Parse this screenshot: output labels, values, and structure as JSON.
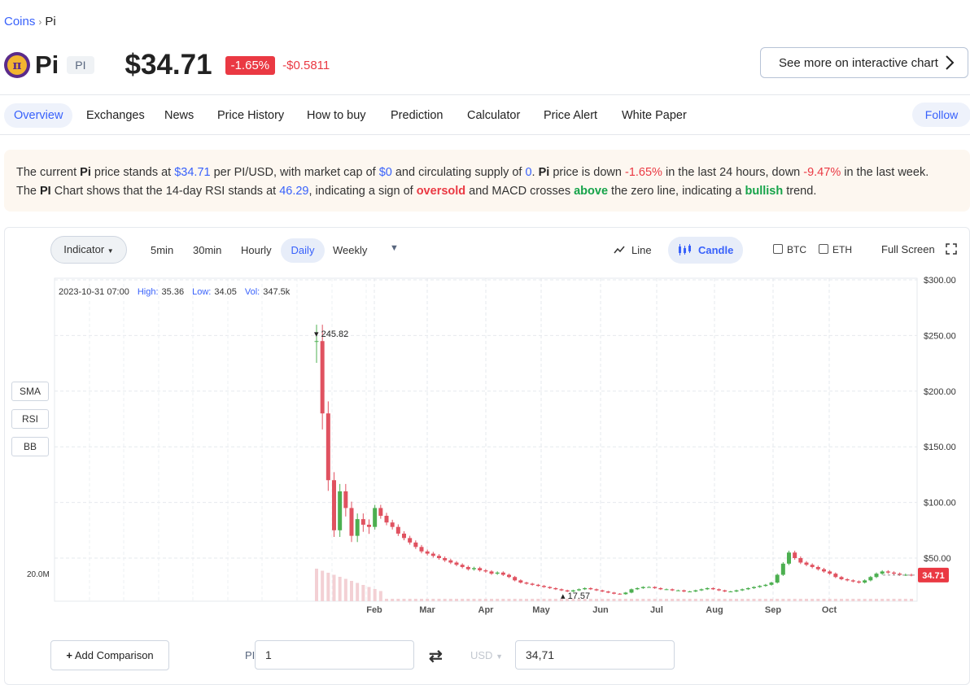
{
  "breadcrumb": {
    "root": "Coins",
    "current": "Pi"
  },
  "coin": {
    "name": "Pi",
    "symbol": "PI",
    "price": "$34.71",
    "change_pct": "-1.65%",
    "change_abs": "-$0.5811"
  },
  "header": {
    "interactive_chart_label": "See more on interactive chart"
  },
  "tabs": [
    "Overview",
    "Exchanges",
    "News",
    "Price History",
    "How to buy",
    "Prediction",
    "Calculator",
    "Price Alert",
    "White Paper"
  ],
  "follow_label": "Follow",
  "summary": {
    "s1": "The current ",
    "coin": "Pi",
    "s2": " price stands at ",
    "price": "$34.71",
    "s3": " per PI/USD, with market cap of ",
    "mcap": "$0",
    "s4": " and circulating supply of ",
    "supply": "0",
    "s5": ". ",
    "coin2": "Pi",
    "s6": " price is down ",
    "d24": "-1.65%",
    "s7": " in the last 24 hours, down ",
    "d7": "-9.47%",
    "s8": " in the last week.",
    "s9": "The ",
    "sym": "PI",
    "s10": " Chart shows that the 14-day RSI stands at ",
    "rsi": "46.29",
    "s11": ", indicating a sign of ",
    "rsi_state": "oversold",
    "s12": " and MACD crosses ",
    "macd": "above",
    "s13": " the zero line, indicating a ",
    "trend": "bullish",
    "s14": " trend."
  },
  "chart_controls": {
    "indicator": "Indicator",
    "timeframes": [
      "5min",
      "30min",
      "Hourly",
      "Daily",
      "Weekly"
    ],
    "active_timeframe": "Daily",
    "line": "Line",
    "candle": "Candle",
    "btc": "BTC",
    "eth": "ETH",
    "fullscreen": "Full Screen",
    "side_buttons": [
      "SMA",
      "RSI",
      "BB"
    ]
  },
  "ohlc_info": {
    "date": "2023-10-31 07:00",
    "high_label": "High:",
    "high": "35.36",
    "low_label": "Low:",
    "low": "34.05",
    "vol_label": "Vol:",
    "vol": "347.5k"
  },
  "chart_data": {
    "type": "candlestick",
    "y_ticks": [
      "$300.00",
      "$250.00",
      "$200.00",
      "$150.00",
      "$100.00",
      "$50.00"
    ],
    "ylim": [
      0,
      300
    ],
    "x_ticks": [
      "Feb",
      "Mar",
      "Apr",
      "May",
      "Jun",
      "Jul",
      "Aug",
      "Sep",
      "Oct"
    ],
    "volume_label": "20.0M",
    "max_label": "245.82",
    "min_label": "17.57",
    "last_price_label": "34.71",
    "grid": true,
    "close_series": [
      245,
      180,
      120,
      75,
      110,
      95,
      70,
      85,
      80,
      78,
      95,
      88,
      82,
      78,
      72,
      68,
      64,
      60,
      56,
      54,
      52,
      50,
      48,
      46,
      44,
      42,
      40,
      41,
      39,
      38,
      36,
      37,
      35,
      33,
      30,
      28,
      27,
      26,
      25,
      24,
      23,
      22,
      21,
      20,
      21,
      22,
      23,
      22,
      21,
      20,
      19,
      18,
      17.6,
      19,
      22,
      23,
      24,
      24,
      23,
      22,
      22,
      21,
      21,
      20,
      20,
      21,
      22,
      23,
      22,
      21,
      20,
      20,
      21,
      22,
      23,
      24,
      25,
      26,
      28,
      35,
      45,
      55,
      50,
      46,
      44,
      42,
      40,
      38,
      36,
      33,
      31,
      30,
      29,
      28,
      30,
      33,
      36,
      38,
      37,
      36,
      35,
      35,
      34.71
    ]
  },
  "converter": {
    "add_comparison": "Add Comparison",
    "from_symbol": "PI",
    "from_value": "1",
    "swap": "⇄",
    "to_symbol": "USD",
    "to_value": "34,71"
  }
}
